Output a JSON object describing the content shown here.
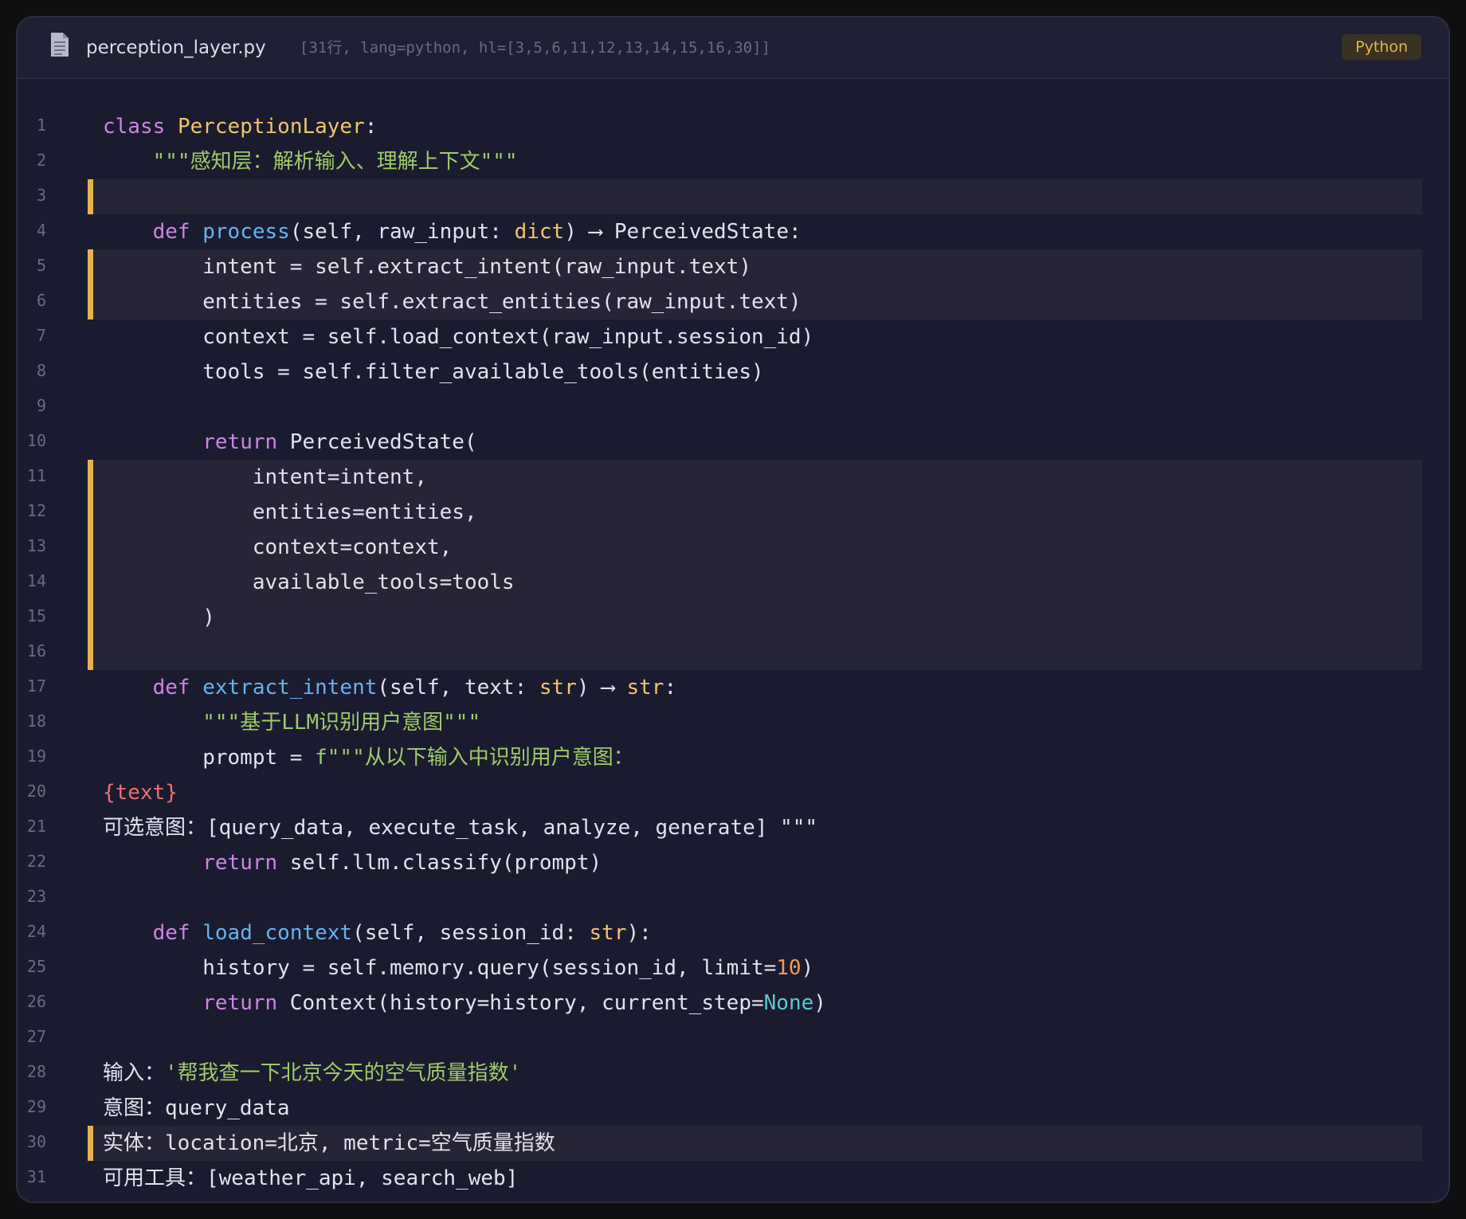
{
  "header": {
    "file_name": "perception_layer.py",
    "file_meta": "[31行, lang=python, hl=[3,5,6,11,12,13,14,15,16,30]]",
    "language": "Python",
    "file_icon": "document-icon"
  },
  "colors": {
    "background": "#1a1b2e",
    "highlight_bar": "#e5b34c",
    "keyword": "#cf84e4",
    "function": "#67b2f0",
    "type": "#f2c46a",
    "string": "#9ecb6a",
    "number": "#f2995a",
    "constant": "#5bc8d6"
  },
  "code": {
    "highlighted_lines": [
      3,
      5,
      6,
      11,
      12,
      13,
      14,
      15,
      16,
      30
    ],
    "lines": [
      {
        "n": "1",
        "tokens": [
          {
            "t": "class",
            "c": "kw"
          },
          {
            "t": " "
          },
          {
            "t": "PerceptionLayer",
            "c": "cls"
          },
          {
            "t": ":"
          }
        ]
      },
      {
        "n": "2",
        "tokens": [
          {
            "t": "    "
          },
          {
            "t": "\"\"\"感知层：解析输入、理解上下文\"\"\"",
            "c": "str"
          }
        ]
      },
      {
        "n": "3",
        "tokens": []
      },
      {
        "n": "4",
        "tokens": [
          {
            "t": "    "
          },
          {
            "t": "def",
            "c": "kw"
          },
          {
            "t": " "
          },
          {
            "t": "process",
            "c": "fn"
          },
          {
            "t": "(self, raw_input: "
          },
          {
            "t": "dict",
            "c": "ty"
          },
          {
            "t": ") ⟶ PerceivedState:"
          }
        ]
      },
      {
        "n": "5",
        "tokens": [
          {
            "t": "        intent = self.extract_intent(raw_input.text)"
          }
        ]
      },
      {
        "n": "6",
        "tokens": [
          {
            "t": "        entities = self.extract_entities(raw_input.text)"
          }
        ]
      },
      {
        "n": "7",
        "tokens": [
          {
            "t": "        context = self.load_context(raw_input.session_id)"
          }
        ]
      },
      {
        "n": "8",
        "tokens": [
          {
            "t": "        tools = self.filter_available_tools(entities)"
          }
        ]
      },
      {
        "n": "9",
        "tokens": []
      },
      {
        "n": "10",
        "tokens": [
          {
            "t": "        "
          },
          {
            "t": "return",
            "c": "kw"
          },
          {
            "t": " PerceivedState("
          }
        ]
      },
      {
        "n": "11",
        "tokens": [
          {
            "t": "            intent=intent,"
          }
        ]
      },
      {
        "n": "12",
        "tokens": [
          {
            "t": "            entities=entities,"
          }
        ]
      },
      {
        "n": "13",
        "tokens": [
          {
            "t": "            context=context,"
          }
        ]
      },
      {
        "n": "14",
        "tokens": [
          {
            "t": "            available_tools=tools"
          }
        ]
      },
      {
        "n": "15",
        "tokens": [
          {
            "t": "        )"
          }
        ]
      },
      {
        "n": "16",
        "tokens": []
      },
      {
        "n": "17",
        "tokens": [
          {
            "t": "    "
          },
          {
            "t": "def",
            "c": "kw"
          },
          {
            "t": " "
          },
          {
            "t": "extract_intent",
            "c": "fn"
          },
          {
            "t": "(self, text: "
          },
          {
            "t": "str",
            "c": "ty"
          },
          {
            "t": ") ⟶ "
          },
          {
            "t": "str",
            "c": "ty"
          },
          {
            "t": ":"
          }
        ]
      },
      {
        "n": "18",
        "tokens": [
          {
            "t": "        "
          },
          {
            "t": "\"\"\"基于LLM识别用户意图\"\"\"",
            "c": "str"
          }
        ]
      },
      {
        "n": "19",
        "tokens": [
          {
            "t": "        prompt = "
          },
          {
            "t": "f\"\"\"从以下输入中识别用户意图：",
            "c": "str"
          }
        ]
      },
      {
        "n": "20",
        "tokens": [
          {
            "t": "{text}",
            "c": "intp"
          }
        ]
      },
      {
        "n": "21",
        "tokens": [
          {
            "t": "可选意图：[query_data, execute_task, analyze, generate] \"\"\""
          }
        ]
      },
      {
        "n": "22",
        "tokens": [
          {
            "t": "        "
          },
          {
            "t": "return",
            "c": "kw"
          },
          {
            "t": " self.llm.classify(prompt)"
          }
        ]
      },
      {
        "n": "23",
        "tokens": []
      },
      {
        "n": "24",
        "tokens": [
          {
            "t": "    "
          },
          {
            "t": "def",
            "c": "kw"
          },
          {
            "t": " "
          },
          {
            "t": "load_context",
            "c": "fn"
          },
          {
            "t": "(self, session_id: "
          },
          {
            "t": "str",
            "c": "ty"
          },
          {
            "t": "):"
          }
        ]
      },
      {
        "n": "25",
        "tokens": [
          {
            "t": "        history = self.memory.query(session_id, limit="
          },
          {
            "t": "10",
            "c": "num"
          },
          {
            "t": ")"
          }
        ]
      },
      {
        "n": "26",
        "tokens": [
          {
            "t": "        "
          },
          {
            "t": "return",
            "c": "kw"
          },
          {
            "t": " Context(history=history, current_step="
          },
          {
            "t": "None",
            "c": "cst"
          },
          {
            "t": ")"
          }
        ]
      },
      {
        "n": "27",
        "tokens": []
      },
      {
        "n": "28",
        "tokens": [
          {
            "t": "输入："
          },
          {
            "t": "'帮我查一下北京今天的空气质量指数'",
            "c": "str"
          }
        ]
      },
      {
        "n": "29",
        "tokens": [
          {
            "t": "意图：query_data"
          }
        ]
      },
      {
        "n": "30",
        "tokens": [
          {
            "t": "实体：location=北京, metric=空气质量指数"
          }
        ]
      },
      {
        "n": "31",
        "tokens": [
          {
            "t": "可用工具：[weather_api, search_web]"
          }
        ]
      }
    ]
  }
}
